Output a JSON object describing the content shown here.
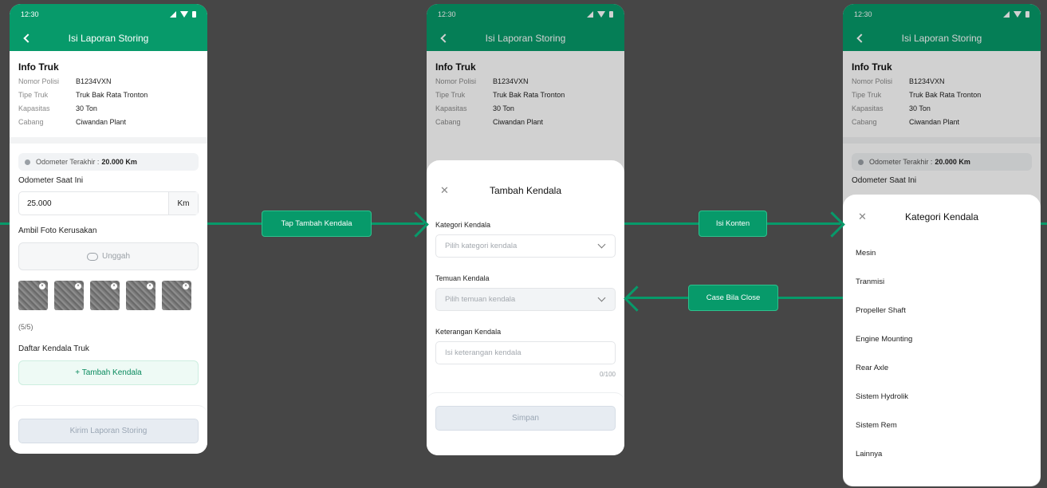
{
  "status_time": "12:30",
  "appbar_title": "Isi Laporan Storing",
  "info": {
    "title": "Info Truk",
    "rows": [
      {
        "k": "Nomor Polisi",
        "v": "B1234VXN"
      },
      {
        "k": "Tipe Truk",
        "v": "Truk Bak Rata Tronton"
      },
      {
        "k": "Kapasitas",
        "v": "30 Ton"
      },
      {
        "k": "Cabang",
        "v": "Ciwandan Plant"
      }
    ]
  },
  "odometer": {
    "note_label": "Odometer Terakhir : ",
    "note_value": "20.000 Km",
    "field_label": "Odometer Saat Ini",
    "value": "25.000",
    "unit": "Km"
  },
  "photos": {
    "label": "Ambil Foto Kerusakan",
    "upload": "Unggah",
    "count": "(5/5)"
  },
  "kendala": {
    "label": "Daftar Kendala Truk",
    "add_button": "+ Tambah Kendala"
  },
  "submit_button": "Kirim Laporan Storing",
  "sheet_add": {
    "title": "Tambah Kendala",
    "kategori_label": "Kategori Kendala",
    "kategori_placeholder": "Pilih kategori kendala",
    "temuan_label": "Temuan Kendala",
    "temuan_placeholder": "Pilih temuan kendala",
    "keterangan_label": "Keterangan Kendala",
    "keterangan_placeholder": "Isi keterangan kendala",
    "counter": "0/100",
    "save": "Simpan"
  },
  "sheet_kategori": {
    "title": "Kategori Kendala",
    "items": [
      "Mesin",
      "Tranmisi",
      "Propeller Shaft",
      "Engine Mounting",
      "Rear Axle",
      "Sistem Hydrolik",
      "Sistem Rem",
      "Lainnya"
    ]
  },
  "flow": {
    "tap_tambah": "Tap Tambah Kendala",
    "isi_konten": "Isi Konten",
    "case_close": "Case Bila Close"
  },
  "colors": {
    "brand": "#079a6a",
    "background": "#464646"
  }
}
